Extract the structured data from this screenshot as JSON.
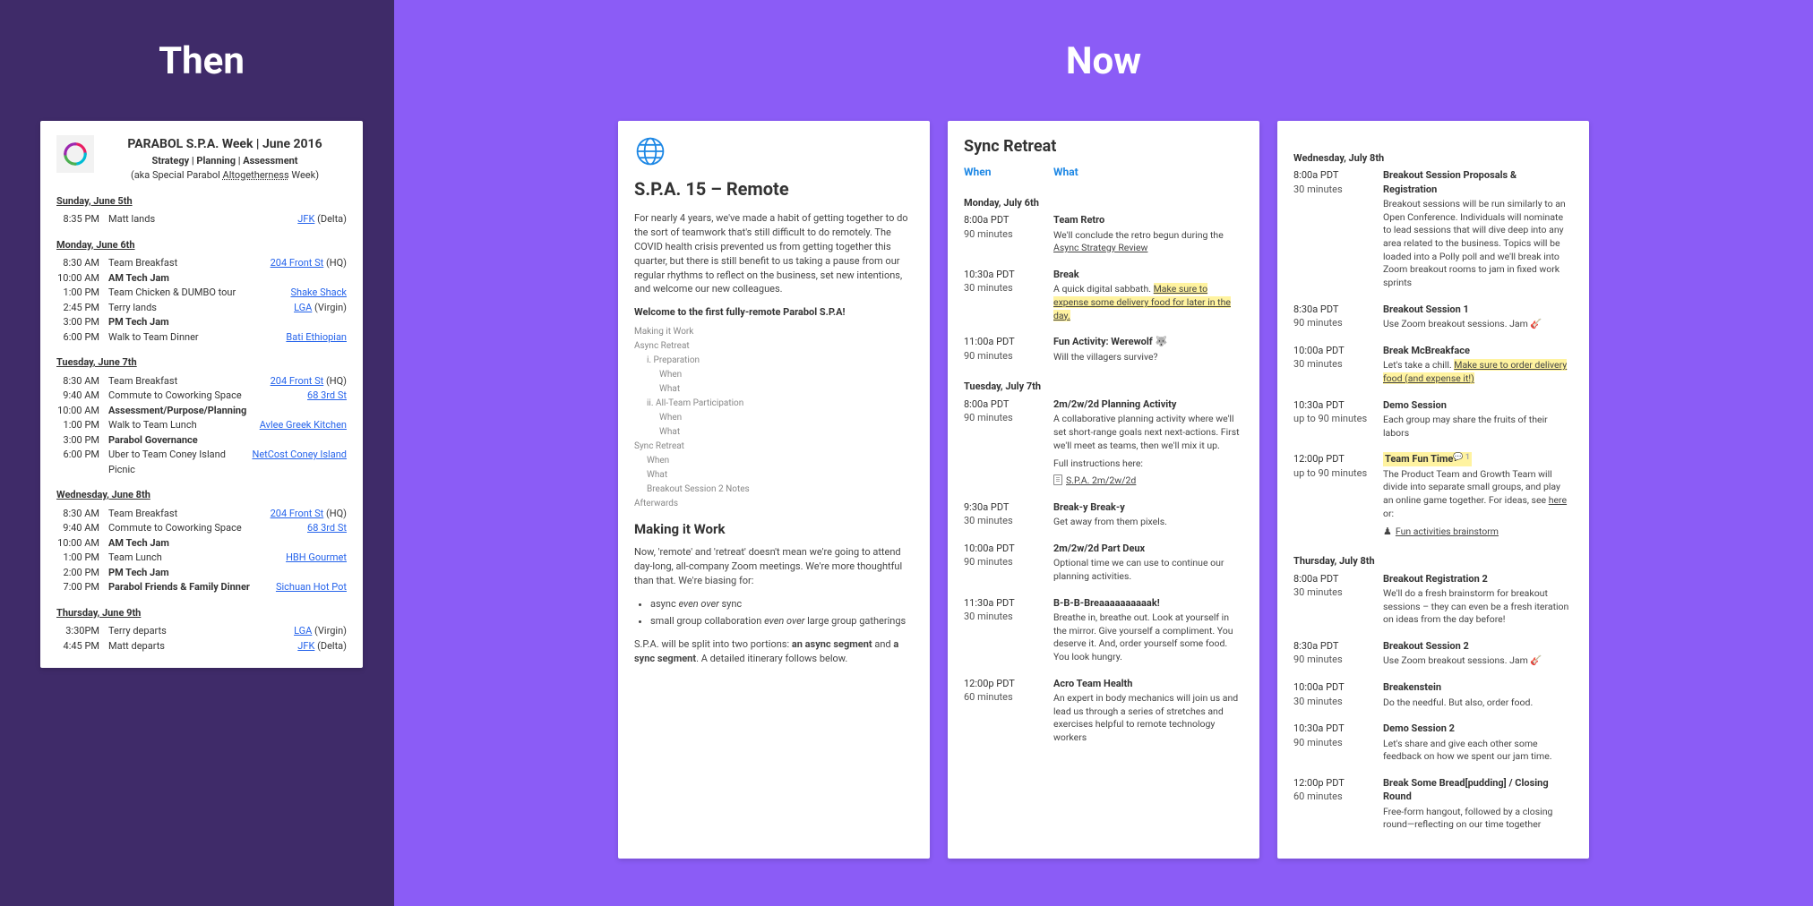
{
  "labels": {
    "then": "Then",
    "now": "Now"
  },
  "cardA": {
    "title": "PARABOL S.P.A. Week | June 2016",
    "subtitle": "Strategy | Planning | Assessment",
    "subtitle2_pre": "(aka Special Parabol ",
    "subtitle2_under": "Altogetherness",
    "subtitle2_post": " Week)",
    "days": [
      {
        "label": "Sunday, June 5th",
        "rows": [
          {
            "time": "8:35 PM",
            "event": "Matt lands",
            "link": "JFK",
            "paren": "(Delta)"
          }
        ]
      },
      {
        "label": "Monday, June 6th",
        "rows": [
          {
            "time": "8:30 AM",
            "event": "Team Breakfast",
            "link": "204 Front St",
            "paren": "(HQ)"
          },
          {
            "time": "10:00 AM",
            "event": "AM Tech Jam",
            "bold": true
          },
          {
            "time": "1:00 PM",
            "event": "Team Chicken & DUMBO tour",
            "link": "Shake Shack"
          },
          {
            "time": "2:45 PM",
            "event": "Terry lands",
            "link": "LGA",
            "paren": "(Virgin)"
          },
          {
            "time": "3:00 PM",
            "event": "PM Tech Jam",
            "bold": true
          },
          {
            "time": "6:00 PM",
            "event": "Walk to Team Dinner",
            "link": "Bati Ethiopian"
          }
        ]
      },
      {
        "label": "Tuesday, June 7th",
        "rows": [
          {
            "time": "8:30 AM",
            "event": "Team Breakfast",
            "link": "204 Front St",
            "paren": "(HQ)"
          },
          {
            "time": "9:40 AM",
            "event": "Commute to Coworking Space",
            "link": "68 3rd St"
          },
          {
            "time": "10:00 AM",
            "event": "Assessment/Purpose/Planning",
            "bold": true
          },
          {
            "time": "1:00 PM",
            "event": "Walk to Team Lunch",
            "link": "Avlee Greek Kitchen"
          },
          {
            "time": "3:00 PM",
            "event": "Parabol Governance",
            "bold": true
          },
          {
            "time": "6:00 PM",
            "event": "Uber to Team Coney Island Picnic",
            "link": "NetCost Coney Island"
          }
        ]
      },
      {
        "label": "Wednesday, June 8th",
        "rows": [
          {
            "time": "8:30 AM",
            "event": "Team Breakfast",
            "link": "204 Front St",
            "paren": "(HQ)"
          },
          {
            "time": "9:40 AM",
            "event": "Commute to Coworking Space",
            "link": "68 3rd St"
          },
          {
            "time": "10:00 AM",
            "event": "AM Tech Jam",
            "bold": true
          },
          {
            "time": "1:00 PM",
            "event": "Team Lunch",
            "link": "HBH Gourmet"
          },
          {
            "time": "2:00 PM",
            "event": "PM Tech Jam",
            "bold": true
          },
          {
            "time": "7:00 PM",
            "event": "Parabol Friends & Family Dinner",
            "bold": true,
            "link": "Sichuan Hot Pot"
          }
        ]
      },
      {
        "label": "Thursday, June 9th",
        "rows": [
          {
            "time": "3:30PM",
            "event": "Terry departs",
            "link": "LGA",
            "paren": "(Virgin)"
          },
          {
            "time": "4:45 PM",
            "event": "Matt departs",
            "link": "JFK",
            "paren": "(Delta)"
          }
        ]
      }
    ]
  },
  "cardB": {
    "h1": "S.P.A. 15 – Remote",
    "intro": "For nearly 4 years, we've made a habit of getting together to do the sort of teamwork that's still difficult to do remotely. The COVID health crisis prevented us from getting together this quarter, but there is still benefit to us taking a pause from our regular rhythms to reflect on the business, set new intentions, and welcome our new colleagues.",
    "welcome": "Welcome to the first fully-remote Parabol S.P.A!",
    "toc": [
      {
        "t": "Making it Work",
        "lvl": 0
      },
      {
        "t": "Async Retreat",
        "lvl": 0
      },
      {
        "t": "i. Preparation",
        "lvl": 1
      },
      {
        "t": "When",
        "lvl": 2
      },
      {
        "t": "What",
        "lvl": 2
      },
      {
        "t": "ii. All-Team Participation",
        "lvl": 1
      },
      {
        "t": "When",
        "lvl": 2
      },
      {
        "t": "What",
        "lvl": 2
      },
      {
        "t": "Sync Retreat",
        "lvl": 0
      },
      {
        "t": "When",
        "lvl": 1
      },
      {
        "t": "What",
        "lvl": 1
      },
      {
        "t": "Breakout Session 2 Notes",
        "lvl": 1
      },
      {
        "t": "Afterwards",
        "lvl": 0
      }
    ],
    "h2": "Making it Work",
    "p2a": "Now, 'remote' and 'retreat' doesn't mean we're going to attend day-long, all-company Zoom meetings. We're more thoughtful than that. We're biasing for:",
    "bul1a": "async ",
    "bul1b": "even over",
    "bul1c": " sync",
    "bul2a": "small group collaboration ",
    "bul2b": "even over",
    "bul2c": " large group gatherings",
    "p3a": "S.P.A. will be split into two portions: ",
    "p3b": "an async segment",
    "p3c": " and ",
    "p3d": "a sync segment",
    "p3e": ". A detailed itinerary follows below."
  },
  "cardC": {
    "title": "Sync Retreat",
    "when": "When",
    "what": "What",
    "days": [
      {
        "label": "Monday, July 6th",
        "slots": [
          {
            "t1": "8:00a PDT",
            "t2": "90 minutes",
            "hd": "Team Retro",
            "bd_pre": "We'll conclude the retro begun during the ",
            "bd_link": "Async Strategy Review",
            "bd_post": ""
          },
          {
            "t1": "10:30a PDT",
            "t2": "30 minutes",
            "hd": "Break",
            "bd_pre": "A quick digital sabbath. ",
            "bd_hl": "Make sure to expense some delivery food for later in the day.",
            "bd_post": ""
          },
          {
            "t1": "11:00a PDT",
            "t2": "90 minutes",
            "hd": "Fun Activity: Werewolf 🐺",
            "bd": "Will the villagers survive?"
          }
        ]
      },
      {
        "label": "Tuesday, July 7th",
        "slots": [
          {
            "t1": "8:00a PDT",
            "t2": "90 minutes",
            "hd": "2m/2w/2d Planning Activity",
            "bd": "A collaborative planning activity where we'll set short-range goals next next-actions. First we'll meet as teams, then we'll mix it up.",
            "extra_label": "Full instructions here:",
            "extra_doc": "S.P.A. 2m/2w/2d"
          },
          {
            "t1": "9:30a PDT",
            "t2": "30 minutes",
            "hd": "Break-y Break-y",
            "bd": "Get away from them pixels."
          },
          {
            "t1": "10:00a PDT",
            "t2": "90 minutes",
            "hd": "2m/2w/2d Part Deux",
            "bd": "Optional time we can use to continue our planning activities."
          },
          {
            "t1": "11:30a PDT",
            "t2": "30 minutes",
            "hd": "B-B-B-Breaaaaaaaaaak!",
            "bd": "Breathe in, breathe out. Look at yourself in the mirror. Give yourself a compliment. You deserve it. And, order yourself some food. You look hungry."
          },
          {
            "t1": "12:00p PDT",
            "t2": "60 minutes",
            "hd": "Acro Team Health",
            "bd": "An expert in body mechanics will join us and lead us through a series of stretches and exercises helpful to remote technology workers"
          }
        ]
      }
    ]
  },
  "cardD": {
    "days": [
      {
        "label": "Wednesday, July 8th",
        "slots": [
          {
            "t1": "8:00a PDT",
            "t2": "30 minutes",
            "hd": "Breakout Session Proposals & Registration",
            "bd_pre": "Breakout sessions will be run similarly to an Open Conference. Individuals will nominate to lead sessions that will dive deep into ",
            "bd_em": "any",
            "bd_post": " area related to the business. Topics will be loaded into a Polly poll and we'll break into Zoom breakout rooms to jam in fixed work sprints"
          },
          {
            "t1": "8:30a PDT",
            "t2": "90 minutes",
            "hd": "Breakout Session 1",
            "bd": "Use Zoom breakout sessions. Jam 🎸"
          },
          {
            "t1": "10:00a PDT",
            "t2": "30 minutes",
            "hd": "Break McBreakface",
            "bd_pre": "Let's take a chill. ",
            "bd_hl": "Make sure to order delivery food (and expense it!)",
            "bd_post": ""
          },
          {
            "t1": "10:30a PDT",
            "t2": "up to 90 minutes",
            "hd": "Demo Session",
            "bd": "Each group may share the fruits of their labors"
          },
          {
            "t1": "12:00p PDT",
            "t2": "up to 90 minutes",
            "hd": "Team Fun Time",
            "hd_hl": true,
            "comment": "💬 1",
            "bd_pre": "The Product Team and Growth Team will divide into separate small groups, and play an online game together. For ideas, see ",
            "bd_link": "here",
            "bd_post": " or:",
            "extra_pawn": "♟",
            "extra_doc": "Fun activities brainstorm"
          }
        ]
      },
      {
        "label": "Thursday, July 8th",
        "slots": [
          {
            "t1": "8:00a PDT",
            "t2": "30 minutes",
            "hd": "Breakout Registration 2",
            "bd": "We'll do a fresh brainstorm for breakout sessions – they can even be a fresh iteration on ideas from the day before!"
          },
          {
            "t1": "8:30a PDT",
            "t2": "90 minutes",
            "hd": "Breakout Session 2",
            "bd": "Use Zoom breakout sessions. Jam 🎸"
          },
          {
            "t1": "10:00a PDT",
            "t2": "30 minutes",
            "hd": "Breakenstein",
            "bd": "Do the needful. But also, order food."
          },
          {
            "t1": "10:30a PDT",
            "t2": "90 minutes",
            "hd": "Demo Session 2",
            "bd": "Let's share and give each other some feedback on how we spent our jam time."
          },
          {
            "t1": "12:00p PDT",
            "t2": "60 minutes",
            "hd": "Break Some Bread[pudding] / Closing Round",
            "bd": "Free-form hangout, followed by a closing round—reflecting on our time together"
          }
        ]
      }
    ]
  }
}
